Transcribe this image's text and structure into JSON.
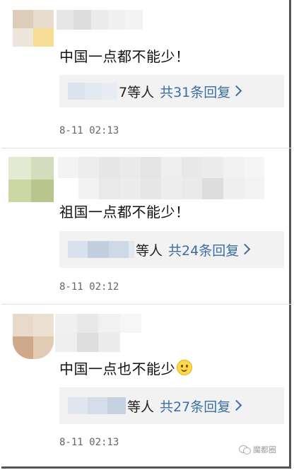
{
  "comments": [
    {
      "text": "中国一点都不能少！",
      "reply_suffix": "7等人",
      "reply_link": "共31条回复",
      "time": "8-11 02:13",
      "has_emoji": false,
      "avatar_colors": [
        "#e8d9cc",
        "#f3e6d7",
        "#f5dfc0",
        "#f0d890"
      ],
      "name_colors": [
        "#dcdcdc",
        "#e4e4e4",
        "#ececec",
        "#efefef",
        "#f2f2f2"
      ],
      "reply_name_colors": [
        "#dfe6ef",
        "#e5eaf1",
        "#e9edf3"
      ]
    },
    {
      "text": "祖国一点都不能少！",
      "reply_suffix": "等人",
      "reply_link": "共24条回复",
      "time": "8-11 02:12",
      "has_emoji": false,
      "avatar_colors": [
        "#e6ecd6",
        "#d9e2c3",
        "#cdd9a8",
        "#bcc98f"
      ],
      "name_colors": [
        "#f0f0f0",
        "#e6e6e6",
        "#ececec",
        "#dedede",
        "#e9e9e9",
        "#f3f3f3"
      ],
      "reply_name_colors": [
        "#d8e0ea",
        "#c5d1e0",
        "#d0dae6",
        "#e3e8ef"
      ]
    },
    {
      "text": "中国一点也不能少",
      "reply_suffix": "等人",
      "reply_link": "共27条回复",
      "time": "8-11 02:13",
      "has_emoji": true,
      "avatar_colors": [
        "#e9dccd",
        "#ddc9b3",
        "#c9a98c",
        "#e3cdb6"
      ],
      "name_colors": [
        "#ececec",
        "#e3e3e3",
        "#efefef",
        "#f4f4f4"
      ],
      "reply_name_colors": [
        "#e2e7ee",
        "#d7dee8",
        "#c9d3e1"
      ]
    }
  ],
  "watermark": "魔都圈"
}
